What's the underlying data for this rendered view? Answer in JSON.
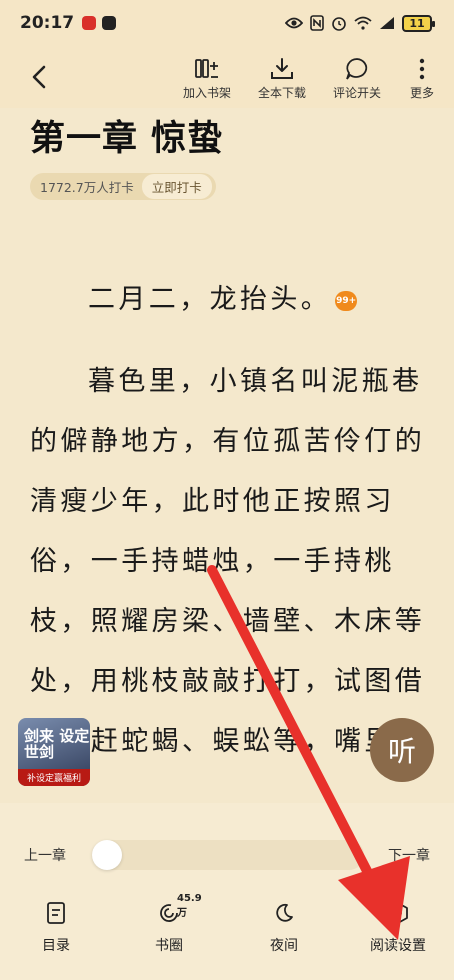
{
  "status_bar": {
    "time": "20:17",
    "battery": "11",
    "icons": [
      "eye-icon",
      "nfc-icon",
      "alarm-icon",
      "wifi-icon",
      "signal-icon"
    ]
  },
  "toolbar": {
    "add_to_shelf": "加入书架",
    "download_all": "全本下载",
    "comment_toggle": "评论开关",
    "more": "更多"
  },
  "chapter": {
    "title": "第一章 惊蛰",
    "checkin_count": "1772.7万人打卡",
    "checkin_button": "立即打卡",
    "para1": "二月二，龙抬头。",
    "para1_badge": "99+",
    "lines": [
      "暮色里，小镇名叫泥瓶巷",
      "的僻静地方，有位孤苦伶仃的",
      "清瘦少年，此时他正按照习",
      "俗，一手持蜡烛，一手持桃",
      "枝，照耀房梁、墙壁、木床等",
      "处，用桃枝敲敲打打，试图借",
      "此驱赶蛇蝎、蜈蚣等，嘴里"
    ]
  },
  "floating": {
    "game_ad_title": "剑来 设定世剑",
    "game_ad_sub": "补设定赢福利",
    "listen_button": "听"
  },
  "reader_nav": {
    "prev": "上一章",
    "next": "下一章",
    "progress": 0.0
  },
  "tabbar": {
    "toc": "目录",
    "circle": "书圈",
    "circle_badge": "45.9万",
    "night": "夜间",
    "settings": "阅读设置"
  },
  "colors": {
    "background": "#f4e8cc",
    "listen_button": "#8a6a4a",
    "annotation_arrow": "#e8312b",
    "comment_badge": "#f08a1c"
  }
}
